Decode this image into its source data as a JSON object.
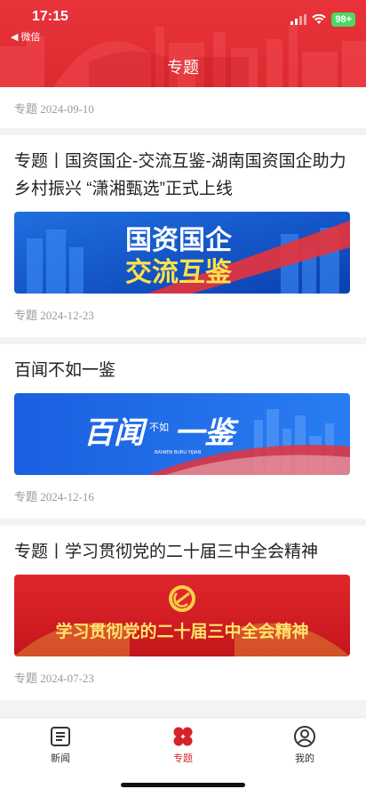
{
  "status_bar": {
    "time": "17:15",
    "back_label": "◀ 微信",
    "battery": "98+"
  },
  "header": {
    "title": "专题",
    "accent_color": "#e8333a"
  },
  "feed": {
    "top_item": {
      "date": "专题 2024-09-10"
    },
    "items": [
      {
        "title": "专题丨国资国企-交流互鉴-湖南国资国企助力乡村振兴 “潇湘甄选”正式上线",
        "banner_text_line1": "国资国企",
        "banner_text_line2": "交流互鉴",
        "date": "专题 2024-12-23"
      },
      {
        "title": "百闻不如一鉴",
        "banner_text_main": "百闻",
        "banner_text_small": "不如",
        "banner_text_end": "一鉴",
        "banner_text_pinyin": "BAIWEN BURU YIJIAN",
        "date": "专题 2024-12-16"
      },
      {
        "title": "专题丨学习贯彻党的二十届三中全会精神",
        "banner_text": "学习贯彻党的二十届三中全会精神",
        "date": "专题 2024-07-23"
      }
    ]
  },
  "tabbar": {
    "tabs": [
      {
        "label": "新闻",
        "icon": "news-icon"
      },
      {
        "label": "专题",
        "icon": "topics-grid-icon",
        "active": true
      },
      {
        "label": "我的",
        "icon": "profile-icon"
      }
    ],
    "active_color": "#d6222a"
  }
}
